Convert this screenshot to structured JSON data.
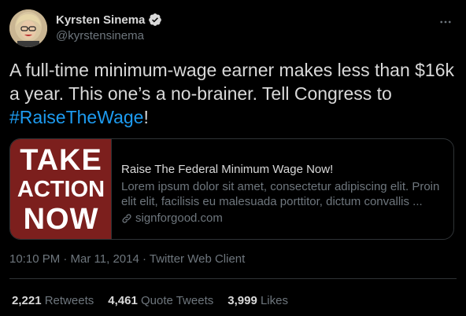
{
  "author": {
    "display_name": "Kyrsten Sinema",
    "handle": "@kyrstensinema",
    "verified": true
  },
  "tweet": {
    "text_before": "A full-time minimum-wage earner makes less than $16k a year. This one’s a no-brainer. Tell Congress to ",
    "hashtag": "#RaiseTheWage",
    "text_after": "!"
  },
  "card": {
    "image_lines": [
      "TAKE",
      "ACTION",
      "NOW"
    ],
    "image_bg": "#7c1f1d",
    "title": "Raise The Federal Minimum Wage Now!",
    "description": "Lorem ipsum dolor sit amet, consectetur adipiscing elit. Proin elit elit, facilisis eu malesuada porttitor, dictum convallis ...",
    "domain": "signforgood.com"
  },
  "meta": {
    "text": "10:10 PM · Mar 11, 2014 · Twitter Web Client"
  },
  "stats": {
    "retweets_count": "2,221",
    "retweets_label": "Retweets",
    "quotes_count": "4,461",
    "quotes_label": "Quote Tweets",
    "likes_count": "3,999",
    "likes_label": "Likes"
  },
  "icons": {
    "verified": "verified-badge-icon",
    "more": "more-options-icon",
    "link": "link-icon"
  },
  "colors": {
    "background": "#000000",
    "text": "#d9d9d9",
    "secondary": "#6e767d",
    "accent": "#1d9bf0",
    "border": "#2f3336"
  }
}
